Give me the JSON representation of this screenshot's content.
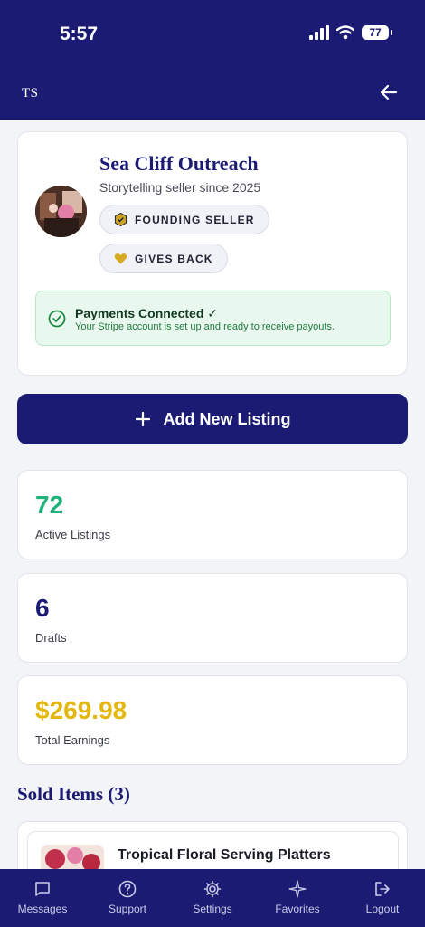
{
  "status_bar": {
    "time": "5:57",
    "battery": "77"
  },
  "header": {
    "logo": "TS"
  },
  "profile": {
    "name": "Sea Cliff Outreach",
    "since": "Storytelling seller since 2025",
    "badges": [
      {
        "label": "FOUNDING SELLER"
      },
      {
        "label": "GIVES BACK"
      }
    ],
    "payments": {
      "title": "Payments Connected ✓",
      "subtitle": "Your Stripe account is set up and ready to receive payouts."
    }
  },
  "add_listing_label": "Add New Listing",
  "stats": [
    {
      "value": "72",
      "label": "Active Listings"
    },
    {
      "value": "6",
      "label": "Drafts"
    },
    {
      "value": "$269.98",
      "label": "Total Earnings"
    }
  ],
  "sold": {
    "title": "Sold Items (3)",
    "items": [
      {
        "name": "Tropical Floral Serving Platters"
      }
    ]
  },
  "nav": [
    {
      "label": "Messages",
      "icon": "message-icon"
    },
    {
      "label": "Support",
      "icon": "help-icon"
    },
    {
      "label": "Settings",
      "icon": "gear-icon"
    },
    {
      "label": "Favorites",
      "icon": "sparkle-icon"
    },
    {
      "label": "Logout",
      "icon": "logout-icon"
    }
  ],
  "colors": {
    "brand": "#1c1b74",
    "active_listings": "#1fb27a",
    "drafts": "#1c1b74",
    "earnings": "#e3b70e",
    "success": "#1e7a3c"
  }
}
